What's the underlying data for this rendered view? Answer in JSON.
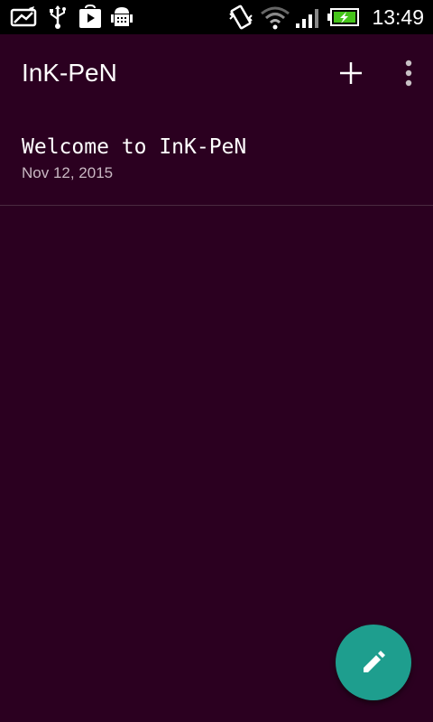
{
  "status_bar": {
    "time": "13:49",
    "icons": [
      "image-icon",
      "usb-icon",
      "play-store-icon",
      "android-debug-icon",
      "vibrate-icon",
      "wifi-icon",
      "signal-icon",
      "battery-charging-icon"
    ]
  },
  "app_bar": {
    "title": "InK-PeN",
    "actions": [
      "add-icon",
      "overflow-menu-icon"
    ]
  },
  "notes": [
    {
      "title": "Welcome to InK-PeN",
      "date": "Nov 12, 2015"
    }
  ],
  "fab": {
    "icon": "edit-icon",
    "color": "#1e9e8e"
  },
  "colors": {
    "background": "#2b0020",
    "status_bar": "#000000",
    "accent": "#1e9e8e"
  }
}
